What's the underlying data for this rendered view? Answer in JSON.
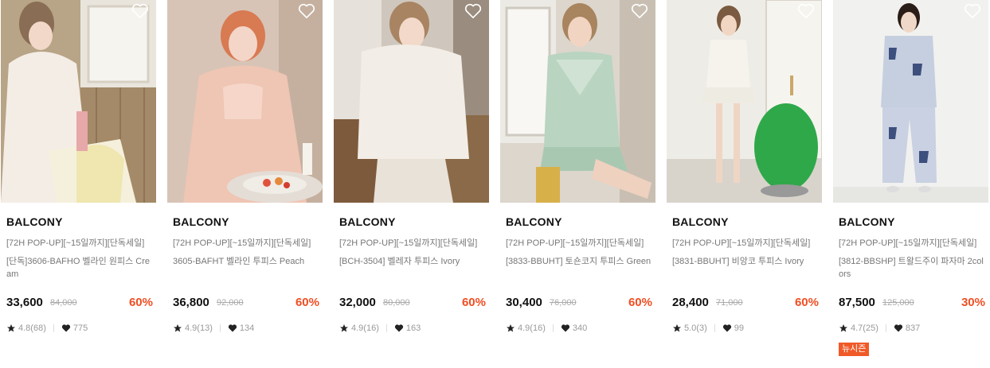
{
  "products": [
    {
      "brand": "BALCONY",
      "promo": "[72H POP-UP][~15일까지][단독세일]",
      "name": "[단독]3606-BAFHO 벨라인 원피스 Cream",
      "price": "33,600",
      "original_price": "84,000",
      "discount": "60%",
      "rating": "4.8(68)",
      "likes": "775",
      "badge": "",
      "wishlist_icon": "heart-outline-icon"
    },
    {
      "brand": "BALCONY",
      "promo": "[72H POP-UP][~15일까지][단독세일]",
      "name": "3605-BAFHT 벨라인 투피스 Peach",
      "price": "36,800",
      "original_price": "92,000",
      "discount": "60%",
      "rating": "4.9(13)",
      "likes": "134",
      "badge": "",
      "wishlist_icon": "heart-outline-icon"
    },
    {
      "brand": "BALCONY",
      "promo": "[72H POP-UP][~15일까지][단독세일]",
      "name": "[BCH-3504] 벨레자 투피스 Ivory",
      "price": "32,000",
      "original_price": "80,000",
      "discount": "60%",
      "rating": "4.9(16)",
      "likes": "163",
      "badge": "",
      "wishlist_icon": "heart-outline-icon"
    },
    {
      "brand": "BALCONY",
      "promo": "[72H POP-UP][~15일까지][단독세일]",
      "name": "[3833-BBUHT] 토숀코지 투피스 Green",
      "price": "30,400",
      "original_price": "76,000",
      "discount": "60%",
      "rating": "4.9(16)",
      "likes": "340",
      "badge": "",
      "wishlist_icon": "heart-outline-icon"
    },
    {
      "brand": "BALCONY",
      "promo": "[72H POP-UP][~15일까지][단독세일]",
      "name": "[3831-BBUHT] 비앙코 투피스 Ivory",
      "price": "28,400",
      "original_price": "71,000",
      "discount": "60%",
      "rating": "5.0(3)",
      "likes": "99",
      "badge": "",
      "wishlist_icon": "heart-outline-icon"
    },
    {
      "brand": "BALCONY",
      "promo": "[72H POP-UP][~15일까지][단독세일]",
      "name": "[3812-BBSHP] 트왈드주이 파자마 2colors",
      "price": "87,500",
      "original_price": "125,000",
      "discount": "30%",
      "rating": "4.7(25)",
      "likes": "837",
      "badge": "뉴시즌",
      "wishlist_icon": "heart-outline-icon"
    }
  ],
  "colors": {
    "discount": "#f04e23",
    "badge": "#f05a28",
    "muted_text": "#777777"
  },
  "icons": {
    "rating": "star-icon",
    "likes": "heart-filled-icon",
    "wishlist": "heart-outline-icon"
  }
}
